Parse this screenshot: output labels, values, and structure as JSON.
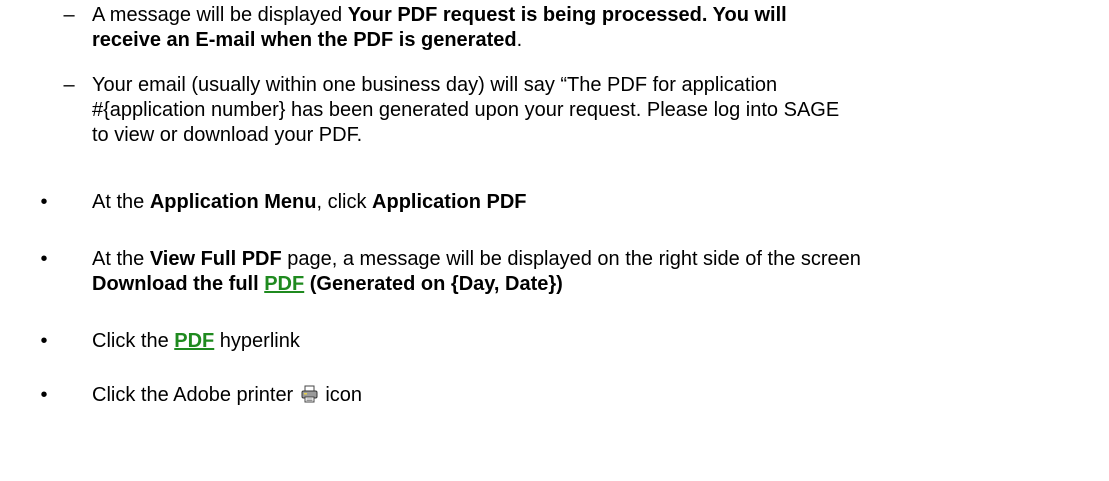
{
  "sub_items": [
    {
      "marker": "–",
      "lines": [
        [
          {
            "t": "A message will be displayed ",
            "b": false
          },
          {
            "t": "Your PDF request is being processed.  You will",
            "b": true
          }
        ],
        [
          {
            "t": "receive an E-mail when the PDF is generated",
            "b": true
          },
          {
            "t": ".",
            "b": false
          }
        ]
      ]
    },
    {
      "marker": "–",
      "lines": [
        [
          {
            "t": "Your email (usually within one business day) will say “The PDF for application",
            "b": false
          }
        ],
        [
          {
            "t": "#{application number} has been generated upon your request. Please log into SAGE",
            "b": false
          }
        ],
        [
          {
            "t": "to view or download your PDF.",
            "b": false
          }
        ]
      ]
    }
  ],
  "bullet_marker": "•",
  "bullets": {
    "b1": {
      "pre": "At the ",
      "menu": "Application Menu",
      "mid": ", click ",
      "action": "Application PDF"
    },
    "b2": {
      "pre": "At the ",
      "page": "View Full PDF",
      "mid": " page, a message will be displayed on the right side of the screen",
      "msg_pre": "Download the full ",
      "msg_link": "PDF",
      "msg_post": " (Generated on {Day, Date})"
    },
    "b3": {
      "pre": "Click the ",
      "link": "PDF",
      "post": " hyperlink"
    },
    "b4": {
      "pre": "Click the Adobe printer ",
      "icon": "printer-icon",
      "post": " icon"
    }
  },
  "colors": {
    "link": "#1f8a1f",
    "text": "#000000"
  }
}
